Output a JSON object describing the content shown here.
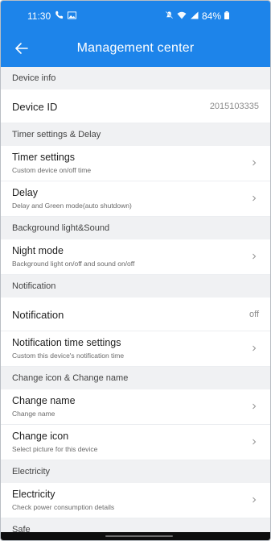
{
  "status_bar": {
    "time": "11:30",
    "left_icons": [
      "call-icon",
      "image-icon"
    ],
    "right_icons": [
      "silent-icon",
      "wifi-icon",
      "signal-icon",
      "battery-icon"
    ],
    "battery": "84%"
  },
  "header": {
    "title": "Management center",
    "back_icon": "arrow-left-icon"
  },
  "sections": {
    "device_info": "Device info",
    "timer": "Timer settings & Delay",
    "background": "Background light&Sound",
    "notification": "Notification",
    "change": "Change icon & Change name",
    "electricity": "Electricity",
    "safe": "Safe"
  },
  "rows": {
    "device_id": {
      "title": "Device ID",
      "value": "2015103335"
    },
    "timer_settings": {
      "title": "Timer settings",
      "sub": "Custom device on/off time"
    },
    "delay": {
      "title": "Delay",
      "sub": "Delay and Green mode(auto shutdown)"
    },
    "night_mode": {
      "title": "Night mode",
      "sub": "Background light on/off and sound on/off"
    },
    "notification": {
      "title": "Notification",
      "value": "off"
    },
    "notification_time": {
      "title": "Notification time settings",
      "sub": "Custom this device's notification time"
    },
    "change_name": {
      "title": "Change name",
      "sub": "Change name"
    },
    "change_icon": {
      "title": "Change icon",
      "sub": "Select picture for this device"
    },
    "electricity": {
      "title": "Electricity",
      "sub": "Check power consumption details"
    }
  },
  "colors": {
    "accent": "#1d84ea",
    "section_bg": "#f0f1f3",
    "row_bg": "#ffffff"
  }
}
